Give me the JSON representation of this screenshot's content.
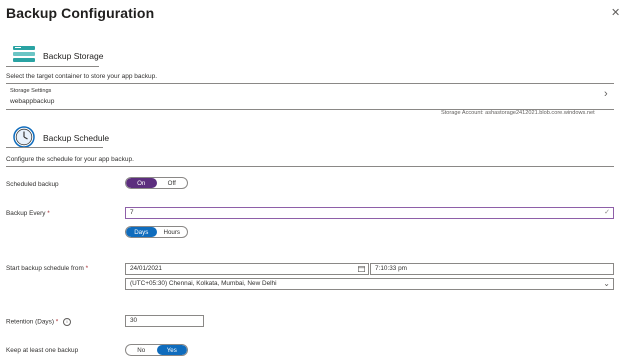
{
  "panel": {
    "title": "Backup Configuration",
    "close_icon": "close-icon"
  },
  "storage": {
    "heading": "Backup Storage",
    "description": "Select the target container to store your app backup.",
    "settings_label": "Storage Settings",
    "settings_value": "webappbackup",
    "account_text": "Storage Account: ashastorage2412021.blob.core.windows.net"
  },
  "schedule": {
    "heading": "Backup Schedule",
    "description": "Configure the schedule for your app backup.",
    "scheduled_label": "Scheduled backup",
    "scheduled_on": "On",
    "scheduled_off": "Off",
    "every_label": "Backup Every",
    "every_value": "7",
    "unit_days": "Days",
    "unit_hours": "Hours",
    "start_label": "Start backup schedule from",
    "start_date": "24/01/2021",
    "start_time": "7:10:33 pm",
    "timezone": "(UTC+05:30) Chennai, Kolkata, Mumbai, New Delhi",
    "retention_label": "Retention (Days)",
    "retention_value": "30",
    "keep_label": "Keep at least one backup",
    "keep_no": "No",
    "keep_yes": "Yes",
    "required_mark": "*"
  },
  "colors": {
    "toggle_purple": "#5c2e7e",
    "toggle_blue": "#0f6cbd",
    "storage_icon": "#2aa3a3",
    "clock_icon": "#0f6cbd",
    "required": "#a4262c"
  }
}
